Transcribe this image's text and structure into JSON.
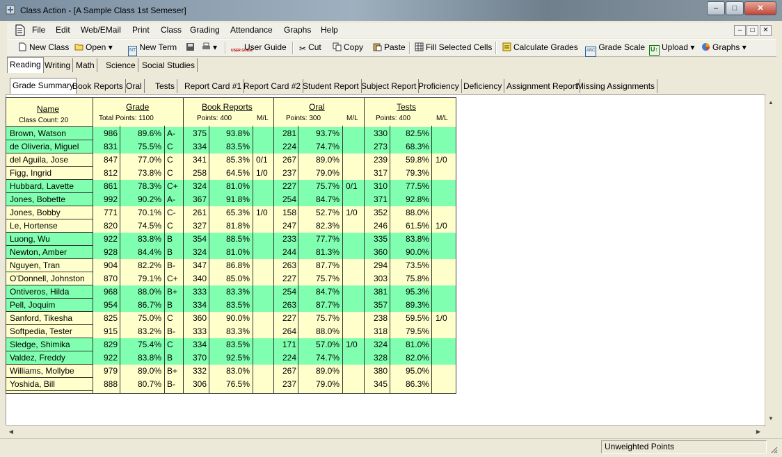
{
  "window": {
    "title": "Class Action - [A Sample Class 1st Semeser]",
    "minimize": "–",
    "maximize": "□",
    "close": "✕"
  },
  "menu": [
    "File",
    "Edit",
    "Web/EMail",
    "Print",
    "Class",
    "Grading",
    "Attendance",
    "Graphs",
    "Help"
  ],
  "toolbar": {
    "new_class": "New Class",
    "open": "Open",
    "new_term": "New Term",
    "user_guide": "User Guide",
    "cut": "Cut",
    "copy": "Copy",
    "paste": "Paste",
    "fill_selected": "Fill Selected Cells",
    "calculate_grades": "Calculate Grades",
    "grade_scale": "Grade Scale",
    "upload": "Upload",
    "graphs": "Graphs",
    "user_guide_icon_text": "USER GUIDE",
    "new_term_icon_text": "NT",
    "grade_scale_icon_text": "ABC",
    "upload_icon_text": "U↑"
  },
  "subject_tabs": [
    "Reading",
    "Writing",
    "Math",
    "Science",
    "Social Studies"
  ],
  "report_tabs": [
    "Grade Summary",
    "Book Reports",
    "Oral",
    "Tests",
    "Report Card #1",
    "Report Card #2",
    "Student Report",
    "Subject Report",
    "Proficiency",
    "Deficiency",
    "Assignment Report",
    "Missing Assignments"
  ],
  "grid": {
    "name_header": "Name",
    "class_count": "Class Count: 20",
    "grade_header": "Grade",
    "total_points": "Total Points: 1100",
    "book_header": "Book Reports",
    "book_points": "Points: 400",
    "oral_header": "Oral",
    "oral_points": "Points: 300",
    "tests_header": "Tests",
    "tests_points": "Points: 400",
    "ml": "M/L",
    "rows": [
      {
        "name": "Brown, Watson",
        "pts": "986",
        "pct": "89.6%",
        "grade": "A-",
        "b": "375",
        "bp": "93.8%",
        "bm": "",
        "o": "281",
        "op": "93.7%",
        "om": "",
        "t": "330",
        "tp": "82.5%",
        "tm": "",
        "green": true
      },
      {
        "name": "de Oliveria, Miguel",
        "pts": "831",
        "pct": "75.5%",
        "grade": "C",
        "b": "334",
        "bp": "83.5%",
        "bm": "",
        "o": "224",
        "op": "74.7%",
        "om": "",
        "t": "273",
        "tp": "68.3%",
        "tm": "",
        "green": true
      },
      {
        "name": "del Aguila, Jose",
        "pts": "847",
        "pct": "77.0%",
        "grade": "C",
        "b": "341",
        "bp": "85.3%",
        "bm": "0/1",
        "o": "267",
        "op": "89.0%",
        "om": "",
        "t": "239",
        "tp": "59.8%",
        "tm": "1/0",
        "green": false
      },
      {
        "name": "Figg, Ingrid",
        "pts": "812",
        "pct": "73.8%",
        "grade": "C",
        "b": "258",
        "bp": "64.5%",
        "bm": "1/0",
        "o": "237",
        "op": "79.0%",
        "om": "",
        "t": "317",
        "tp": "79.3%",
        "tm": "",
        "green": false
      },
      {
        "name": "Hubbard, Lavette",
        "pts": "861",
        "pct": "78.3%",
        "grade": "C+",
        "b": "324",
        "bp": "81.0%",
        "bm": "",
        "o": "227",
        "op": "75.7%",
        "om": "0/1",
        "t": "310",
        "tp": "77.5%",
        "tm": "",
        "green": true
      },
      {
        "name": "Jones, Bobette",
        "pts": "992",
        "pct": "90.2%",
        "grade": "A-",
        "b": "367",
        "bp": "91.8%",
        "bm": "",
        "o": "254",
        "op": "84.7%",
        "om": "",
        "t": "371",
        "tp": "92.8%",
        "tm": "",
        "green": true
      },
      {
        "name": "Jones, Bobby",
        "pts": "771",
        "pct": "70.1%",
        "grade": "C-",
        "b": "261",
        "bp": "65.3%",
        "bm": "1/0",
        "o": "158",
        "op": "52.7%",
        "om": "1/0",
        "t": "352",
        "tp": "88.0%",
        "tm": "",
        "green": false
      },
      {
        "name": "Le, Hortense",
        "pts": "820",
        "pct": "74.5%",
        "grade": "C",
        "b": "327",
        "bp": "81.8%",
        "bm": "",
        "o": "247",
        "op": "82.3%",
        "om": "",
        "t": "246",
        "tp": "61.5%",
        "tm": "1/0",
        "green": false
      },
      {
        "name": "Luong, Wu",
        "pts": "922",
        "pct": "83.8%",
        "grade": "B",
        "b": "354",
        "bp": "88.5%",
        "bm": "",
        "o": "233",
        "op": "77.7%",
        "om": "",
        "t": "335",
        "tp": "83.8%",
        "tm": "",
        "green": true
      },
      {
        "name": "Newton, Amber",
        "pts": "928",
        "pct": "84.4%",
        "grade": "B",
        "b": "324",
        "bp": "81.0%",
        "bm": "",
        "o": "244",
        "op": "81.3%",
        "om": "",
        "t": "360",
        "tp": "90.0%",
        "tm": "",
        "green": true
      },
      {
        "name": "Nguyen, Tran",
        "pts": "904",
        "pct": "82.2%",
        "grade": "B-",
        "b": "347",
        "bp": "86.8%",
        "bm": "",
        "o": "263",
        "op": "87.7%",
        "om": "",
        "t": "294",
        "tp": "73.5%",
        "tm": "",
        "green": false
      },
      {
        "name": "O'Donnell, Johnston",
        "pts": "870",
        "pct": "79.1%",
        "grade": "C+",
        "b": "340",
        "bp": "85.0%",
        "bm": "",
        "o": "227",
        "op": "75.7%",
        "om": "",
        "t": "303",
        "tp": "75.8%",
        "tm": "",
        "green": false
      },
      {
        "name": "Ontiveros, Hilda",
        "pts": "968",
        "pct": "88.0%",
        "grade": "B+",
        "b": "333",
        "bp": "83.3%",
        "bm": "",
        "o": "254",
        "op": "84.7%",
        "om": "",
        "t": "381",
        "tp": "95.3%",
        "tm": "",
        "green": true
      },
      {
        "name": "Pell, Joquim",
        "pts": "954",
        "pct": "86.7%",
        "grade": "B",
        "b": "334",
        "bp": "83.5%",
        "bm": "",
        "o": "263",
        "op": "87.7%",
        "om": "",
        "t": "357",
        "tp": "89.3%",
        "tm": "",
        "green": true
      },
      {
        "name": "Sanford, Tikesha",
        "pts": "825",
        "pct": "75.0%",
        "grade": "C",
        "b": "360",
        "bp": "90.0%",
        "bm": "",
        "o": "227",
        "op": "75.7%",
        "om": "",
        "t": "238",
        "tp": "59.5%",
        "tm": "1/0",
        "green": false
      },
      {
        "name": "Softpedia, Tester",
        "pts": "915",
        "pct": "83.2%",
        "grade": "B-",
        "b": "333",
        "bp": "83.3%",
        "bm": "",
        "o": "264",
        "op": "88.0%",
        "om": "",
        "t": "318",
        "tp": "79.5%",
        "tm": "",
        "green": false
      },
      {
        "name": "Sledge, Shimika",
        "pts": "829",
        "pct": "75.4%",
        "grade": "C",
        "b": "334",
        "bp": "83.5%",
        "bm": "",
        "o": "171",
        "op": "57.0%",
        "om": "1/0",
        "t": "324",
        "tp": "81.0%",
        "tm": "",
        "green": true
      },
      {
        "name": "Valdez, Freddy",
        "pts": "922",
        "pct": "83.8%",
        "grade": "B",
        "b": "370",
        "bp": "92.5%",
        "bm": "",
        "o": "224",
        "op": "74.7%",
        "om": "",
        "t": "328",
        "tp": "82.0%",
        "tm": "",
        "green": true
      },
      {
        "name": "Williams, Mollybe",
        "pts": "979",
        "pct": "89.0%",
        "grade": "B+",
        "b": "332",
        "bp": "83.0%",
        "bm": "",
        "o": "267",
        "op": "89.0%",
        "om": "",
        "t": "380",
        "tp": "95.0%",
        "tm": "",
        "green": false
      },
      {
        "name": "Yoshida,  Bill",
        "pts": "888",
        "pct": "80.7%",
        "grade": "B-",
        "b": "306",
        "bp": "76.5%",
        "bm": "",
        "o": "237",
        "op": "79.0%",
        "om": "",
        "t": "345",
        "tp": "86.3%",
        "tm": "",
        "green": false
      }
    ]
  },
  "status": {
    "mode": "Unweighted Points"
  },
  "colors": {
    "row_highlight": "#80ffb0",
    "row_default": "#ffffcc"
  }
}
